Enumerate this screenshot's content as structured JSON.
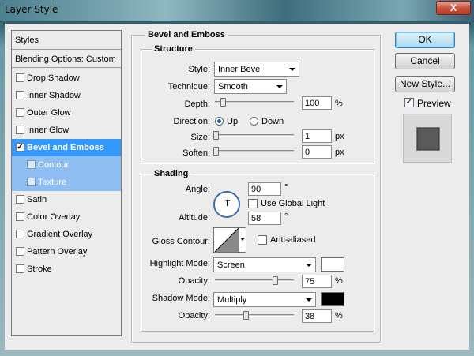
{
  "window": {
    "title": "Layer Style",
    "close_label": "X"
  },
  "styles_panel": {
    "header": "Styles",
    "blending_options": "Blending Options: Custom",
    "items": [
      {
        "label": "Drop Shadow",
        "checked": false,
        "state": "normal"
      },
      {
        "label": "Inner Shadow",
        "checked": false,
        "state": "normal"
      },
      {
        "label": "Outer Glow",
        "checked": false,
        "state": "normal"
      },
      {
        "label": "Inner Glow",
        "checked": false,
        "state": "normal"
      },
      {
        "label": "Bevel and Emboss",
        "checked": true,
        "state": "selected"
      },
      {
        "label": "Contour",
        "checked": false,
        "state": "sub"
      },
      {
        "label": "Texture",
        "checked": false,
        "state": "sub"
      },
      {
        "label": "Satin",
        "checked": false,
        "state": "normal"
      },
      {
        "label": "Color Overlay",
        "checked": false,
        "state": "normal"
      },
      {
        "label": "Gradient Overlay",
        "checked": false,
        "state": "normal"
      },
      {
        "label": "Pattern Overlay",
        "checked": false,
        "state": "normal"
      },
      {
        "label": "Stroke",
        "checked": false,
        "state": "normal"
      }
    ]
  },
  "bevel": {
    "section_title": "Bevel and Emboss",
    "structure": {
      "title": "Structure",
      "style_label": "Style:",
      "style_value": "Inner Bevel",
      "technique_label": "Technique:",
      "technique_value": "Smooth",
      "depth_label": "Depth:",
      "depth_value": "100",
      "depth_unit": "%",
      "direction_label": "Direction:",
      "direction_up": "Up",
      "direction_down": "Down",
      "direction_selected": "Up",
      "size_label": "Size:",
      "size_value": "1",
      "size_unit": "px",
      "soften_label": "Soften:",
      "soften_value": "0",
      "soften_unit": "px"
    },
    "shading": {
      "title": "Shading",
      "angle_label": "Angle:",
      "angle_value": "90",
      "angle_unit": "°",
      "use_global_light_label": "Use Global Light",
      "use_global_light_checked": false,
      "altitude_label": "Altitude:",
      "altitude_value": "58",
      "altitude_unit": "°",
      "gloss_contour_label": "Gloss Contour:",
      "anti_aliased_label": "Anti-aliased",
      "anti_aliased_checked": false,
      "highlight_mode_label": "Highlight Mode:",
      "highlight_mode_value": "Screen",
      "highlight_color": "#ffffff",
      "highlight_opacity_label": "Opacity:",
      "highlight_opacity_value": "75",
      "highlight_opacity_unit": "%",
      "shadow_mode_label": "Shadow Mode:",
      "shadow_mode_value": "Multiply",
      "shadow_color": "#000000",
      "shadow_opacity_label": "Opacity:",
      "shadow_opacity_value": "38",
      "shadow_opacity_unit": "%"
    }
  },
  "buttons": {
    "ok": "OK",
    "cancel": "Cancel",
    "new_style": "New Style...",
    "preview_label": "Preview",
    "preview_checked": true
  },
  "colors": {
    "selection": "#3399ff",
    "sub_selection": "#8ebef2"
  }
}
